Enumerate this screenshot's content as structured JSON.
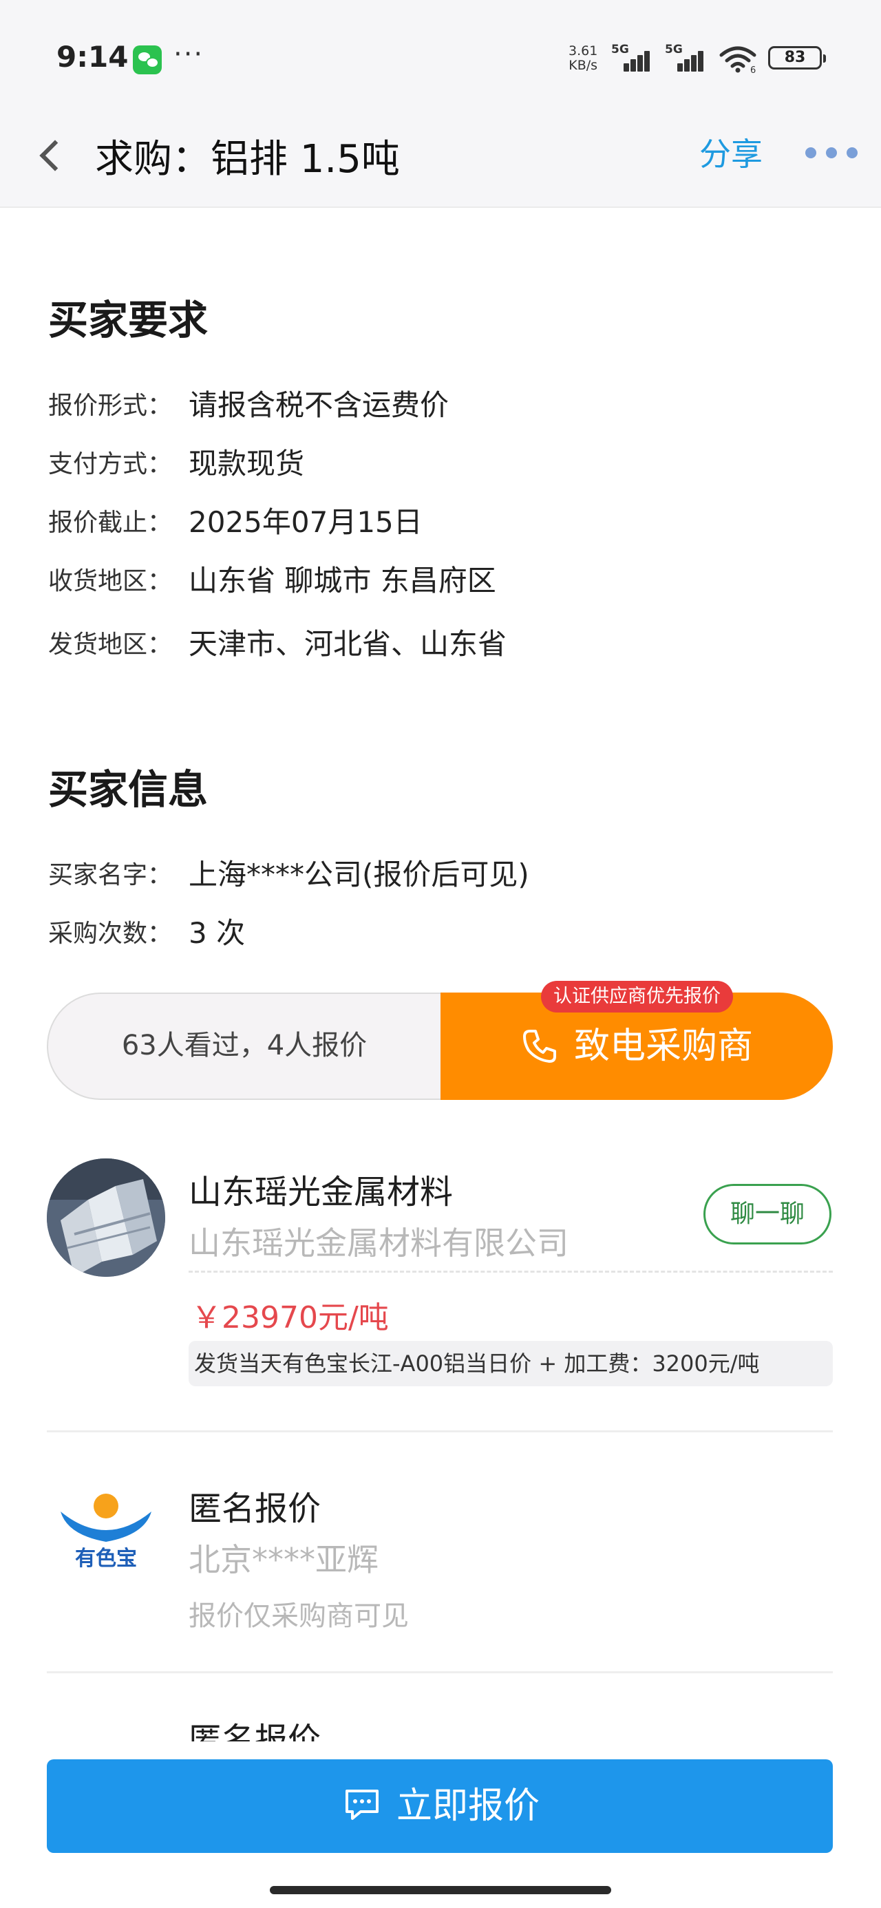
{
  "status_bar": {
    "time": "9:14",
    "dots": "···",
    "speed_value": "3.61",
    "speed_unit": "KB/s",
    "network1": "5G",
    "network2": "5G",
    "wifi_level": "6",
    "battery": "83"
  },
  "nav": {
    "title": "求购：铝排 1.5吨",
    "share_label": "分享"
  },
  "requirements": {
    "title": "买家要求",
    "rows": [
      {
        "label": "报价形式：",
        "value": "请报含税不含运费价"
      },
      {
        "label": "支付方式：",
        "value": "现款现货"
      },
      {
        "label": "报价截止：",
        "value": "2025年07月15日"
      },
      {
        "label": "收货地区：",
        "value": "山东省 聊城市 东昌府区"
      },
      {
        "label": "发货地区：",
        "value": "天津市、河北省、山东省"
      }
    ]
  },
  "buyer": {
    "title": "买家信息",
    "rows": [
      {
        "label": "买家名字：",
        "value": "上海****公司(报价后可见)"
      },
      {
        "label": "采购次数：",
        "value": "3 次"
      }
    ]
  },
  "action": {
    "stats": "63人看过，4人报价",
    "call_label": "致电采购商",
    "badge": "认证供应商优先报价"
  },
  "quotes": [
    {
      "name": "山东瑶光金属材料",
      "company": "山东瑶光金属材料有限公司",
      "chat_label": "聊一聊",
      "price": "￥23970元/吨",
      "note": "发货当天有色宝长江-A00铝当日价 + 加工费：3200元/吨"
    },
    {
      "name": "匿名报价",
      "company": "北京****亚辉",
      "logo_text": "有色宝",
      "hidden_note": "报价仅采购商可见"
    },
    {
      "name": "匿名报价"
    }
  ],
  "bottom": {
    "quote_label": "立即报价"
  },
  "colors": {
    "accent_blue": "#1e96eb",
    "call_orange": "#ff8c00",
    "price_red": "#e5484d",
    "chat_green": "#3aa14f"
  }
}
